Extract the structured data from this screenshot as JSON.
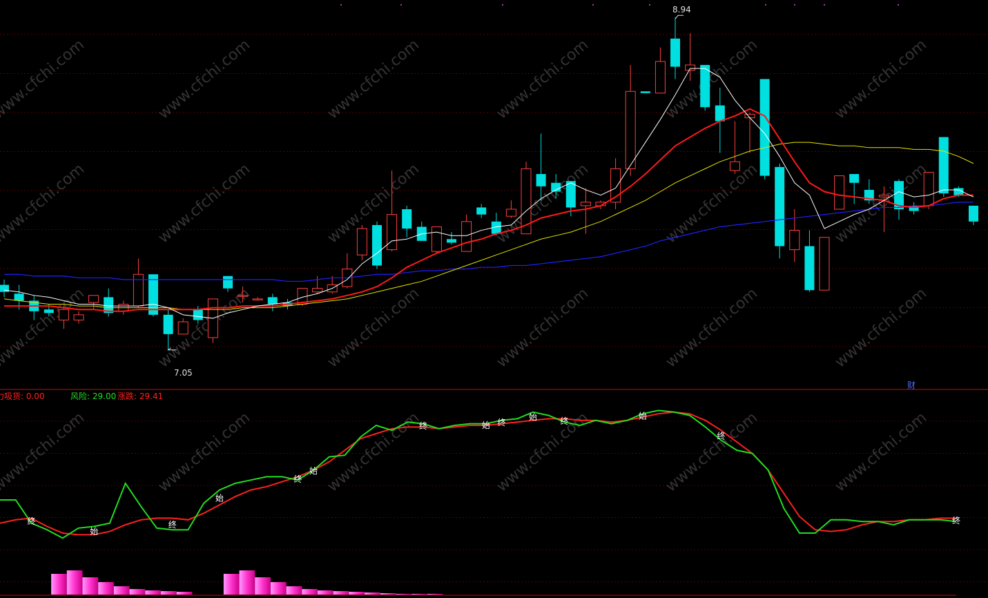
{
  "colors": {
    "background": "#000000",
    "grid": "#5a0000",
    "divider": "#c01010",
    "up": "#ff4040",
    "down": "#00e0e0",
    "ma5": "#ffffff",
    "ma10": "#ff1a1a",
    "ma20": "#e6e600",
    "ma60": "#2020ff",
    "risk": "#22dd22",
    "change": "#ff2020",
    "bars": "#ff33cc",
    "label_green": "#22dd22",
    "label_red": "#ff2020",
    "marker_text": "#ffffff",
    "cai": "#4a6cff"
  },
  "watermark": "www.cfchi.com",
  "header": {
    "capital_label": "力吸货: 0.00",
    "risk_label": "风险: 29.00",
    "change_label": "涨跌: 29.41"
  },
  "annotations": {
    "high_label": "8.94",
    "low_label": "7.05",
    "cai_label": "财"
  },
  "markers": {
    "start": "始",
    "end": "终"
  },
  "chart_data": {
    "type": "candlestick",
    "price_range": [
      6.9,
      9.0
    ],
    "candles": [
      {
        "o": 7.42,
        "h": 7.45,
        "l": 7.35,
        "c": 7.38
      },
      {
        "o": 7.37,
        "h": 7.42,
        "l": 7.28,
        "c": 7.33
      },
      {
        "o": 7.33,
        "h": 7.36,
        "l": 7.22,
        "c": 7.27
      },
      {
        "o": 7.28,
        "h": 7.31,
        "l": 7.24,
        "c": 7.26
      },
      {
        "o": 7.22,
        "h": 7.3,
        "l": 7.17,
        "c": 7.28
      },
      {
        "o": 7.22,
        "h": 7.27,
        "l": 7.2,
        "c": 7.25
      },
      {
        "o": 7.32,
        "h": 7.36,
        "l": 7.28,
        "c": 7.36
      },
      {
        "o": 7.35,
        "h": 7.4,
        "l": 7.24,
        "c": 7.26
      },
      {
        "o": 7.27,
        "h": 7.33,
        "l": 7.25,
        "c": 7.31
      },
      {
        "o": 7.3,
        "h": 7.57,
        "l": 7.29,
        "c": 7.48
      },
      {
        "o": 7.48,
        "h": 7.48,
        "l": 7.24,
        "c": 7.25
      },
      {
        "o": 7.25,
        "h": 7.28,
        "l": 7.05,
        "c": 7.14
      },
      {
        "o": 7.14,
        "h": 7.23,
        "l": 7.14,
        "c": 7.21
      },
      {
        "o": 7.28,
        "h": 7.3,
        "l": 7.2,
        "c": 7.22
      },
      {
        "o": 7.12,
        "h": 7.34,
        "l": 7.09,
        "c": 7.34
      },
      {
        "o": 7.47,
        "h": 7.47,
        "l": 7.38,
        "c": 7.4
      },
      {
        "o": 7.36,
        "h": 7.41,
        "l": 7.32,
        "c": 7.36
      },
      {
        "o": 7.34,
        "h": 7.35,
        "l": 7.33,
        "c": 7.34
      },
      {
        "o": 7.35,
        "h": 7.37,
        "l": 7.27,
        "c": 7.31
      },
      {
        "o": 7.32,
        "h": 7.34,
        "l": 7.28,
        "c": 7.3
      },
      {
        "o": 7.31,
        "h": 7.4,
        "l": 7.3,
        "c": 7.4
      },
      {
        "o": 7.38,
        "h": 7.47,
        "l": 7.37,
        "c": 7.4
      },
      {
        "o": 7.38,
        "h": 7.47,
        "l": 7.37,
        "c": 7.42
      },
      {
        "o": 7.41,
        "h": 7.6,
        "l": 7.4,
        "c": 7.51
      },
      {
        "o": 7.59,
        "h": 7.76,
        "l": 7.56,
        "c": 7.74
      },
      {
        "o": 7.76,
        "h": 7.78,
        "l": 7.51,
        "c": 7.53
      },
      {
        "o": 7.62,
        "h": 8.07,
        "l": 7.61,
        "c": 7.82
      },
      {
        "o": 7.85,
        "h": 7.87,
        "l": 7.69,
        "c": 7.74
      },
      {
        "o": 7.75,
        "h": 7.78,
        "l": 7.67,
        "c": 7.67
      },
      {
        "o": 7.61,
        "h": 7.75,
        "l": 7.6,
        "c": 7.75
      },
      {
        "o": 7.68,
        "h": 7.72,
        "l": 7.65,
        "c": 7.66
      },
      {
        "o": 7.61,
        "h": 7.82,
        "l": 7.61,
        "c": 7.78
      },
      {
        "o": 7.86,
        "h": 7.88,
        "l": 7.8,
        "c": 7.82
      },
      {
        "o": 7.78,
        "h": 7.83,
        "l": 7.7,
        "c": 7.71
      },
      {
        "o": 7.81,
        "h": 7.9,
        "l": 7.8,
        "c": 7.85
      },
      {
        "o": 7.71,
        "h": 8.12,
        "l": 7.71,
        "c": 8.08
      },
      {
        "o": 8.05,
        "h": 8.28,
        "l": 7.9,
        "c": 7.98
      },
      {
        "o": 8.0,
        "h": 8.05,
        "l": 7.91,
        "c": 7.95
      },
      {
        "o": 8.01,
        "h": 8.01,
        "l": 7.81,
        "c": 7.86
      },
      {
        "o": 7.87,
        "h": 7.97,
        "l": 7.71,
        "c": 7.89
      },
      {
        "o": 7.87,
        "h": 7.9,
        "l": 7.85,
        "c": 7.89
      },
      {
        "o": 7.89,
        "h": 8.14,
        "l": 7.85,
        "c": 8.08
      },
      {
        "o": 8.08,
        "h": 8.67,
        "l": 8.04,
        "c": 8.52
      },
      {
        "o": 8.52,
        "h": 8.52,
        "l": 8.51,
        "c": 8.51
      },
      {
        "o": 8.51,
        "h": 8.77,
        "l": 8.51,
        "c": 8.69
      },
      {
        "o": 8.82,
        "h": 8.94,
        "l": 8.59,
        "c": 8.66
      },
      {
        "o": 8.64,
        "h": 8.85,
        "l": 8.58,
        "c": 8.67
      },
      {
        "o": 8.67,
        "h": 8.67,
        "l": 8.41,
        "c": 8.43
      },
      {
        "o": 8.44,
        "h": 8.54,
        "l": 8.17,
        "c": 8.35
      },
      {
        "o": 8.07,
        "h": 8.35,
        "l": 8.05,
        "c": 8.12
      },
      {
        "o": 8.37,
        "h": 8.4,
        "l": 8.17,
        "c": 8.39
      },
      {
        "o": 8.59,
        "h": 8.59,
        "l": 8.02,
        "c": 8.04
      },
      {
        "o": 8.09,
        "h": 8.11,
        "l": 7.57,
        "c": 7.64
      },
      {
        "o": 7.62,
        "h": 7.85,
        "l": 7.55,
        "c": 7.73
      },
      {
        "o": 7.64,
        "h": 7.73,
        "l": 7.38,
        "c": 7.39
      },
      {
        "o": 7.39,
        "h": 7.69,
        "l": 7.39,
        "c": 7.69
      },
      {
        "o": 7.85,
        "h": 8.04,
        "l": 7.85,
        "c": 8.04
      },
      {
        "o": 8.05,
        "h": 8.05,
        "l": 7.88,
        "c": 8.0
      },
      {
        "o": 7.96,
        "h": 8.02,
        "l": 7.88,
        "c": 7.9
      },
      {
        "o": 7.92,
        "h": 7.98,
        "l": 7.72,
        "c": 7.93
      },
      {
        "o": 8.01,
        "h": 8.02,
        "l": 7.79,
        "c": 7.85
      },
      {
        "o": 7.87,
        "h": 7.89,
        "l": 7.82,
        "c": 7.84
      },
      {
        "o": 7.87,
        "h": 8.06,
        "l": 7.85,
        "c": 8.06
      },
      {
        "o": 8.26,
        "h": 8.26,
        "l": 7.92,
        "c": 7.94
      },
      {
        "o": 7.97,
        "h": 7.98,
        "l": 7.92,
        "c": 7.93
      },
      {
        "o": 7.87,
        "h": 7.87,
        "l": 7.76,
        "c": 7.78
      }
    ],
    "ma5": [
      7.39,
      7.38,
      7.36,
      7.35,
      7.33,
      7.31,
      7.31,
      7.3,
      7.3,
      7.3,
      7.31,
      7.29,
      7.25,
      7.24,
      7.23,
      7.26,
      7.28,
      7.3,
      7.31,
      7.32,
      7.35,
      7.37,
      7.4,
      7.45,
      7.54,
      7.6,
      7.67,
      7.68,
      7.71,
      7.72,
      7.7,
      7.7,
      7.73,
      7.75,
      7.76,
      7.84,
      7.91,
      7.96,
      8.0,
      7.96,
      7.93,
      7.97,
      8.1,
      8.23,
      8.36,
      8.5,
      8.65,
      8.65,
      8.6,
      8.47,
      8.37,
      8.28,
      8.15,
      8.0,
      7.93,
      7.74,
      7.78,
      7.82,
      7.85,
      7.9,
      7.95,
      7.92,
      7.93,
      7.96,
      7.96,
      7.92
    ],
    "ma10": [
      7.3,
      7.3,
      7.3,
      7.3,
      7.29,
      7.28,
      7.28,
      7.27,
      7.27,
      7.28,
      7.28,
      7.28,
      7.28,
      7.28,
      7.29,
      7.29,
      7.3,
      7.3,
      7.3,
      7.31,
      7.32,
      7.33,
      7.34,
      7.36,
      7.38,
      7.41,
      7.46,
      7.52,
      7.56,
      7.6,
      7.63,
      7.66,
      7.68,
      7.71,
      7.73,
      7.76,
      7.8,
      7.82,
      7.84,
      7.85,
      7.87,
      7.92,
      7.98,
      8.05,
      8.13,
      8.21,
      8.26,
      8.31,
      8.35,
      8.38,
      8.42,
      8.38,
      8.25,
      8.12,
      8.0,
      7.95,
      7.93,
      7.92,
      7.91,
      7.9,
      7.87,
      7.86,
      7.87,
      7.91,
      7.93,
      7.93
    ],
    "ma20": [
      7.34,
      7.33,
      7.32,
      7.31,
      7.31,
      7.3,
      7.3,
      7.29,
      7.29,
      7.29,
      7.29,
      7.29,
      7.28,
      7.28,
      7.28,
      7.28,
      7.29,
      7.29,
      7.29,
      7.3,
      7.31,
      7.32,
      7.33,
      7.34,
      7.36,
      7.38,
      7.4,
      7.42,
      7.44,
      7.47,
      7.5,
      7.53,
      7.56,
      7.59,
      7.62,
      7.65,
      7.68,
      7.7,
      7.72,
      7.75,
      7.78,
      7.82,
      7.86,
      7.9,
      7.95,
      8.0,
      8.04,
      8.08,
      8.12,
      8.15,
      8.18,
      8.2,
      8.22,
      8.23,
      8.23,
      8.22,
      8.21,
      8.21,
      8.2,
      8.2,
      8.2,
      8.19,
      8.19,
      8.18,
      8.15,
      8.11
    ],
    "ma60": [
      7.48,
      7.48,
      7.47,
      7.47,
      7.47,
      7.46,
      7.46,
      7.46,
      7.45,
      7.45,
      7.45,
      7.45,
      7.45,
      7.45,
      7.45,
      7.45,
      7.45,
      7.45,
      7.45,
      7.44,
      7.44,
      7.45,
      7.46,
      7.46,
      7.47,
      7.48,
      7.48,
      7.49,
      7.5,
      7.5,
      7.51,
      7.51,
      7.52,
      7.52,
      7.53,
      7.53,
      7.54,
      7.55,
      7.56,
      7.57,
      7.58,
      7.6,
      7.62,
      7.64,
      7.67,
      7.69,
      7.71,
      7.73,
      7.75,
      7.76,
      7.77,
      7.78,
      7.79,
      7.8,
      7.81,
      7.82,
      7.83,
      7.84,
      7.85,
      7.86,
      7.86,
      7.87,
      7.87,
      7.88,
      7.89,
      7.89
    ],
    "risk": [
      40,
      40,
      26,
      22,
      17,
      23,
      24,
      26,
      50,
      36,
      23,
      22,
      22,
      38,
      46,
      50,
      52,
      54,
      54,
      52,
      58,
      66,
      67,
      78,
      85,
      82,
      87,
      86,
      83,
      85,
      86,
      86,
      88,
      89,
      93,
      91,
      87,
      85,
      88,
      86,
      88,
      92,
      94,
      93,
      91,
      84,
      76,
      70,
      68,
      58,
      35,
      20,
      20,
      28,
      28,
      27,
      27,
      25,
      28,
      28,
      28,
      27
    ],
    "change": [
      26,
      28,
      29,
      24,
      20,
      19,
      19,
      21,
      25,
      28,
      29,
      29,
      28,
      32,
      37,
      42,
      46,
      48,
      51,
      54,
      58,
      63,
      70,
      77,
      80,
      83,
      84,
      84,
      83,
      84,
      85,
      85,
      86,
      87,
      88,
      89,
      89,
      88,
      88,
      87,
      88,
      90,
      92,
      93,
      92,
      88,
      82,
      75,
      68,
      58,
      44,
      30,
      22,
      21,
      22,
      25,
      27,
      27,
      28,
      28,
      29,
      29
    ],
    "start_markers": [
      6,
      14,
      20,
      31,
      34,
      41
    ],
    "end_markers": [
      2,
      11,
      19,
      27,
      32,
      36,
      46,
      61
    ],
    "histogram": [
      0,
      0,
      0,
      30,
      35,
      25,
      18,
      12,
      8,
      6,
      5,
      4,
      0,
      0,
      30,
      35,
      25,
      18,
      12,
      8,
      6,
      5,
      4,
      3,
      2,
      1,
      1,
      1,
      0,
      0,
      0,
      0,
      0,
      0,
      0,
      0,
      0,
      0,
      0,
      0,
      0,
      0,
      0,
      0,
      0,
      0,
      0,
      0,
      0,
      0,
      0,
      0,
      0,
      0,
      0,
      0,
      0,
      0,
      0,
      0,
      0,
      0
    ],
    "indicator_range": [
      0,
      100
    ]
  }
}
